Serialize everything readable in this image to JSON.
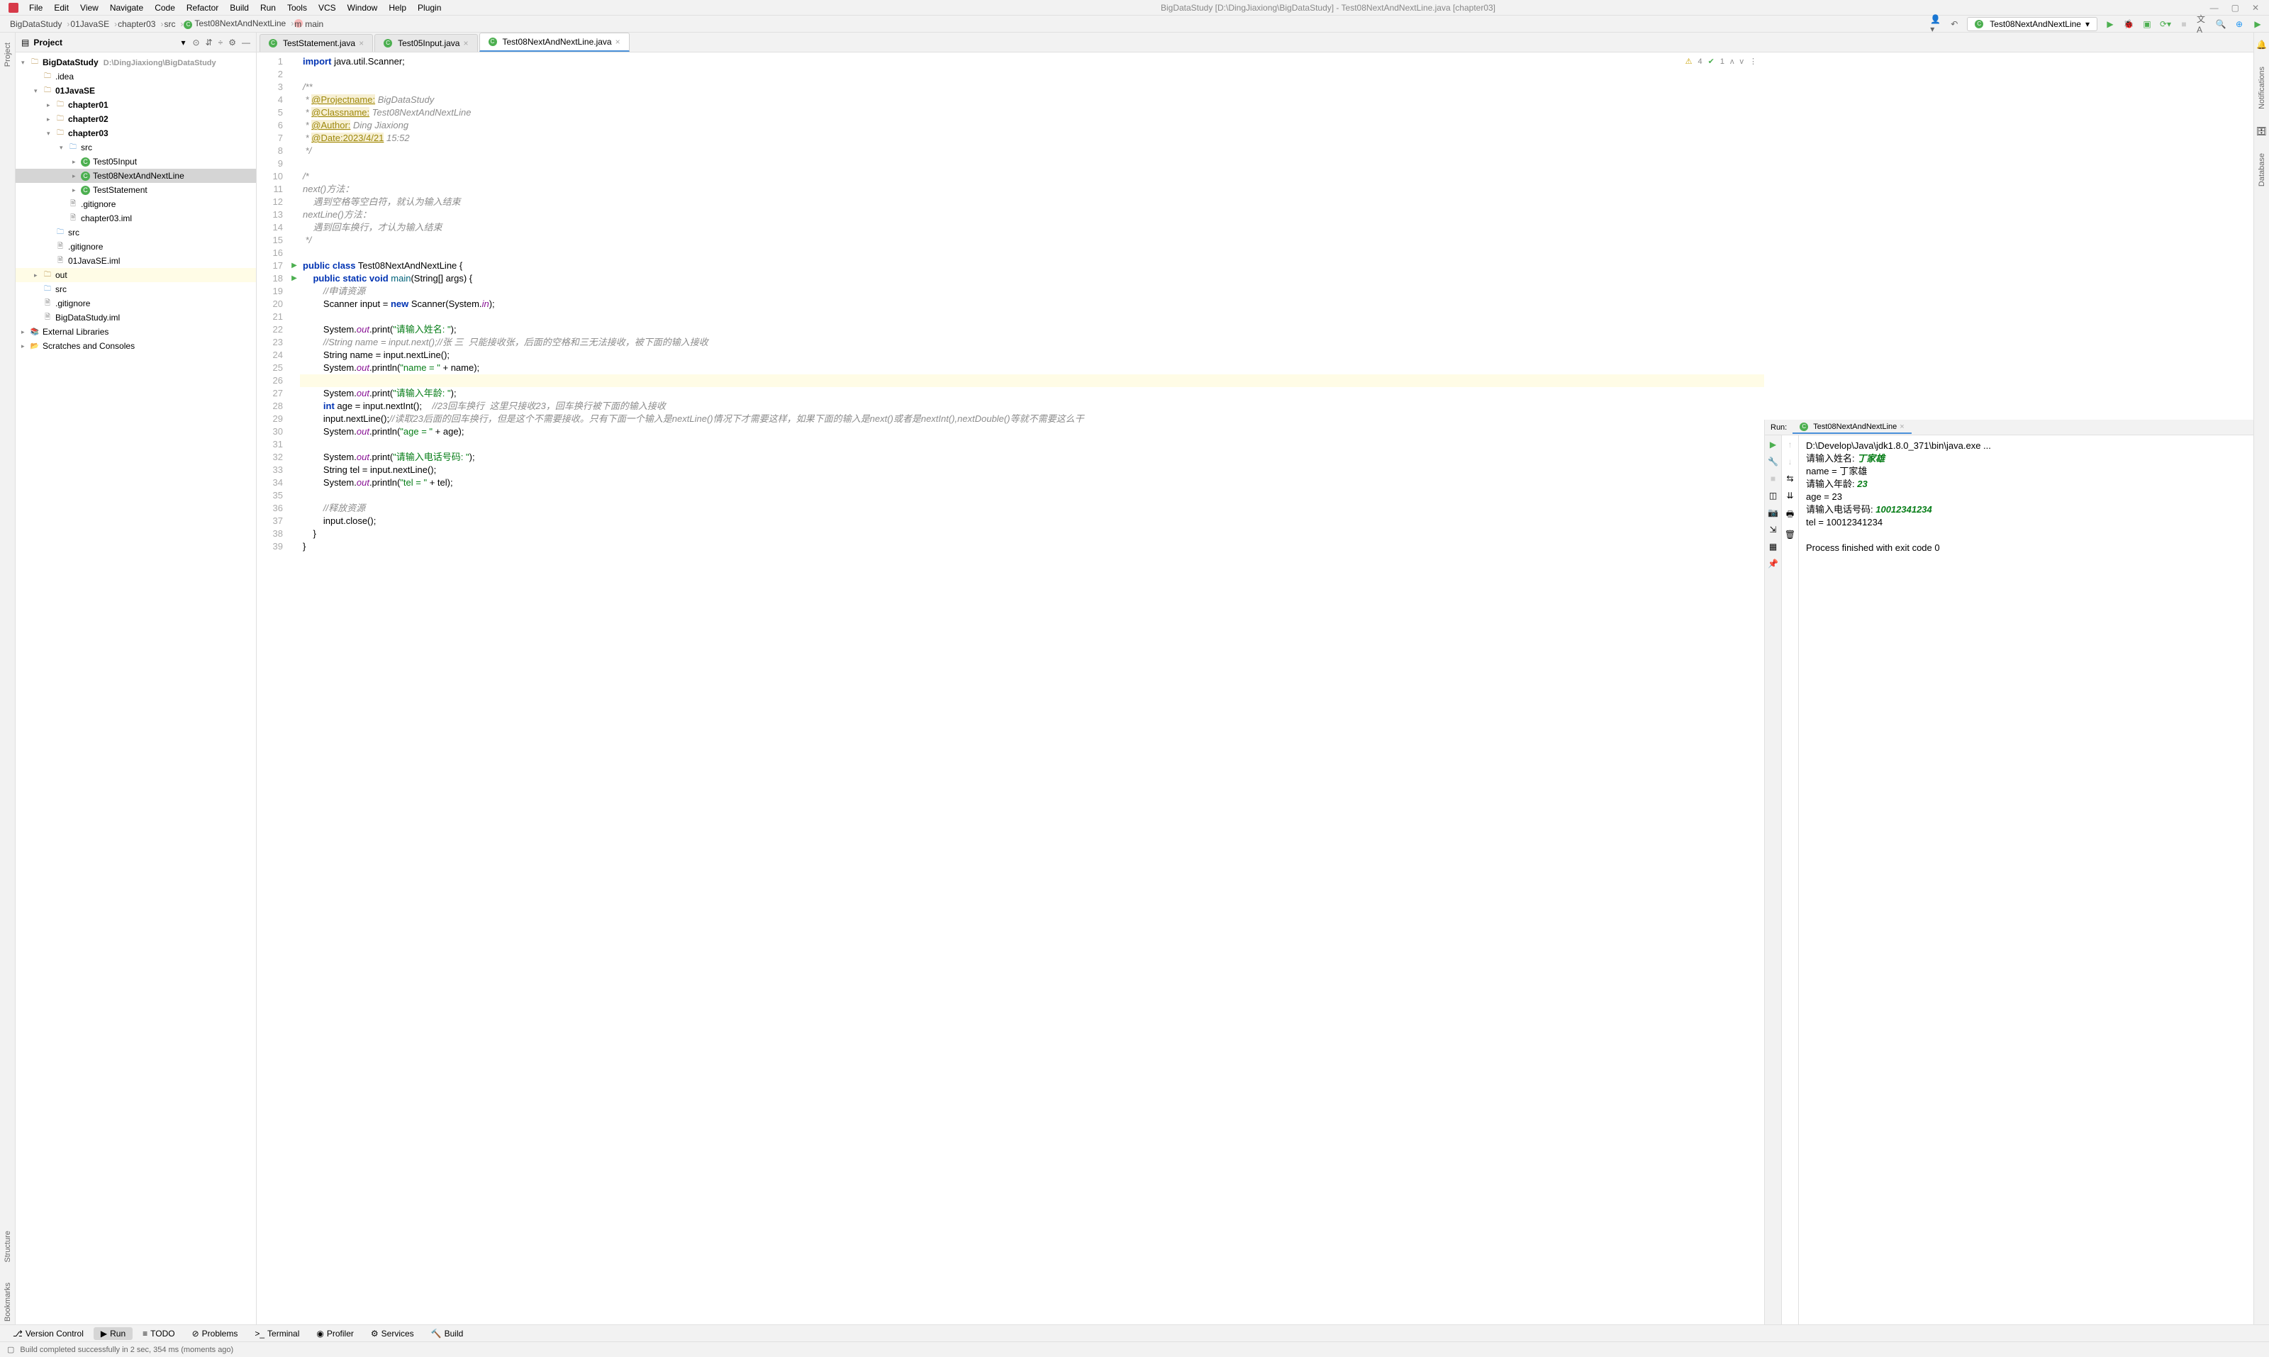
{
  "window": {
    "title": "BigDataStudy [D:\\DingJiaxiong\\BigDataStudy] - Test08NextAndNextLine.java [chapter03]"
  },
  "menu": [
    "File",
    "Edit",
    "View",
    "Navigate",
    "Code",
    "Refactor",
    "Build",
    "Run",
    "Tools",
    "VCS",
    "Window",
    "Help",
    "Plugin"
  ],
  "breadcrumbs": [
    {
      "label": "BigDataStudy"
    },
    {
      "label": "01JavaSE"
    },
    {
      "label": "chapter03"
    },
    {
      "label": "src"
    },
    {
      "label": "Test08NextAndNextLine",
      "icon": "class"
    },
    {
      "label": "main",
      "icon": "method"
    }
  ],
  "run_config": "Test08NextAndNextLine",
  "project_panel": {
    "title": "Project"
  },
  "tree": [
    {
      "indent": 0,
      "arrow": "▾",
      "icon": "folder",
      "label": "BigDataStudy",
      "path": "D:\\DingJiaxiong\\BigDataStudy",
      "bold": true
    },
    {
      "indent": 1,
      "arrow": "",
      "icon": "folder",
      "label": ".idea"
    },
    {
      "indent": 1,
      "arrow": "▾",
      "icon": "folder",
      "label": "01JavaSE",
      "bold": true
    },
    {
      "indent": 2,
      "arrow": "▸",
      "icon": "folder",
      "label": "chapter01",
      "bold": true
    },
    {
      "indent": 2,
      "arrow": "▸",
      "icon": "folder",
      "label": "chapter02",
      "bold": true
    },
    {
      "indent": 2,
      "arrow": "▾",
      "icon": "folder",
      "label": "chapter03",
      "bold": true
    },
    {
      "indent": 3,
      "arrow": "▾",
      "icon": "folder-blue",
      "label": "src"
    },
    {
      "indent": 4,
      "arrow": "▸",
      "icon": "class",
      "label": "Test05Input"
    },
    {
      "indent": 4,
      "arrow": "▸",
      "icon": "class",
      "label": "Test08NextAndNextLine",
      "selected": true
    },
    {
      "indent": 4,
      "arrow": "▸",
      "icon": "class",
      "label": "TestStatement"
    },
    {
      "indent": 3,
      "arrow": "",
      "icon": "file",
      "label": ".gitignore"
    },
    {
      "indent": 3,
      "arrow": "",
      "icon": "file",
      "label": "chapter03.iml"
    },
    {
      "indent": 2,
      "arrow": "",
      "icon": "folder-blue",
      "label": "src"
    },
    {
      "indent": 2,
      "arrow": "",
      "icon": "file",
      "label": ".gitignore"
    },
    {
      "indent": 2,
      "arrow": "",
      "icon": "file",
      "label": "01JavaSE.iml"
    },
    {
      "indent": 1,
      "arrow": "▸",
      "icon": "folder",
      "label": "out",
      "highlighted": true
    },
    {
      "indent": 1,
      "arrow": "",
      "icon": "folder-blue",
      "label": "src"
    },
    {
      "indent": 1,
      "arrow": "",
      "icon": "file",
      "label": ".gitignore"
    },
    {
      "indent": 1,
      "arrow": "",
      "icon": "file",
      "label": "BigDataStudy.iml"
    },
    {
      "indent": 0,
      "arrow": "▸",
      "icon": "lib",
      "label": "External Libraries"
    },
    {
      "indent": 0,
      "arrow": "▸",
      "icon": "scratch",
      "label": "Scratches and Consoles"
    }
  ],
  "tabs": [
    {
      "label": "TestStatement.java"
    },
    {
      "label": "Test05Input.java"
    },
    {
      "label": "Test08NextAndNextLine.java",
      "active": true
    }
  ],
  "editor_status": {
    "warnings": "4",
    "ok": "1"
  },
  "code_lines": [
    {
      "n": 1,
      "html": "<span class='kw'>import</span> java.util.Scanner;"
    },
    {
      "n": 2,
      "html": ""
    },
    {
      "n": 3,
      "html": "<span class='com'>/**</span>"
    },
    {
      "n": 4,
      "html": "<span class='com'> * </span><span class='ann'>@Projectname:</span><span class='com'> BigDataStudy</span>"
    },
    {
      "n": 5,
      "html": "<span class='com'> * </span><span class='ann'>@Classname:</span><span class='com'> Test08NextAndNextLine</span>"
    },
    {
      "n": 6,
      "html": "<span class='com'> * </span><span class='ann'>@Author:</span><span class='com'> Ding Jiaxiong</span>"
    },
    {
      "n": 7,
      "html": "<span class='com'> * </span><span class='ann'>@Date:2023/4/21</span><span class='com'> 15:52</span>"
    },
    {
      "n": 8,
      "html": "<span class='com'> */</span>"
    },
    {
      "n": 9,
      "html": ""
    },
    {
      "n": 10,
      "html": "<span class='com'>/*</span>"
    },
    {
      "n": 11,
      "html": "<span class='com'>next()方法：</span>"
    },
    {
      "n": 12,
      "html": "<span class='com'>    遇到空格等空白符，就认为输入结束</span>"
    },
    {
      "n": 13,
      "html": "<span class='com'>nextLine()方法：</span>"
    },
    {
      "n": 14,
      "html": "<span class='com'>    遇到回车换行，才认为输入结束</span>"
    },
    {
      "n": 15,
      "html": "<span class='com'> */</span>"
    },
    {
      "n": 16,
      "html": ""
    },
    {
      "n": 17,
      "html": "<span class='kw'>public class</span> <span class='type'>Test08NextAndNextLine</span> {",
      "run": true
    },
    {
      "n": 18,
      "html": "    <span class='kw'>public static void</span> <span class='fn'>main</span>(String[] args) {",
      "run": true
    },
    {
      "n": 19,
      "html": "        <span class='com'>//申请资源</span>"
    },
    {
      "n": 20,
      "html": "        Scanner input = <span class='kw'>new</span> Scanner(System.<span class='fld'>in</span>);"
    },
    {
      "n": 21,
      "html": ""
    },
    {
      "n": 22,
      "html": "        System.<span class='fld'>out</span>.print(<span class='str'>\"请输入姓名: \"</span>);"
    },
    {
      "n": 23,
      "html": "        <span class='com'>//String name = input.next();//张 三  只能接收张，后面的空格和三无法接收，被下面的输入接收</span>"
    },
    {
      "n": 24,
      "html": "        String name = input.nextLine();"
    },
    {
      "n": 25,
      "html": "        System.<span class='fld'>out</span>.println(<span class='str'>\"name = \"</span> + name);"
    },
    {
      "n": 26,
      "html": "",
      "hl": true
    },
    {
      "n": 27,
      "html": "        System.<span class='fld'>out</span>.print(<span class='str'>\"请输入年龄: \"</span>);"
    },
    {
      "n": 28,
      "html": "        <span class='kw'>int</span> age = input.nextInt();    <span class='com'>//23回车换行  这里只接收23，回车换行被下面的输入接收</span>"
    },
    {
      "n": 29,
      "html": "        input.nextLine();<span class='com'>//读取23后面的回车换行，但是这个不需要接收。只有下面一个输入是nextLine()情况下才需要这样，如果下面的输入是next()或者是nextInt(),nextDouble()等就不需要这么干</span>"
    },
    {
      "n": 30,
      "html": "        System.<span class='fld'>out</span>.println(<span class='str'>\"age = \"</span> + age);"
    },
    {
      "n": 31,
      "html": ""
    },
    {
      "n": 32,
      "html": "        System.<span class='fld'>out</span>.print(<span class='str'>\"请输入电话号码: \"</span>);"
    },
    {
      "n": 33,
      "html": "        String tel = input.nextLine();"
    },
    {
      "n": 34,
      "html": "        System.<span class='fld'>out</span>.println(<span class='str'>\"tel = \"</span> + tel);"
    },
    {
      "n": 35,
      "html": ""
    },
    {
      "n": 36,
      "html": "        <span class='com'>//释放资源</span>"
    },
    {
      "n": 37,
      "html": "        input.close();"
    },
    {
      "n": 38,
      "html": "    }"
    },
    {
      "n": 39,
      "html": "}"
    }
  ],
  "run_panel": {
    "title": "Run:",
    "tab": "Test08NextAndNextLine",
    "lines": [
      {
        "text": "D:\\Develop\\Java\\jdk1.8.0_371\\bin\\java.exe ..."
      },
      {
        "prefix": "请输入姓名: ",
        "input": "丁家雄"
      },
      {
        "text": "name = 丁家雄"
      },
      {
        "prefix": "请输入年龄: ",
        "input": "23"
      },
      {
        "text": "age = 23"
      },
      {
        "prefix": "请输入电话号码: ",
        "input": "10012341234"
      },
      {
        "text": "tel = 10012341234"
      },
      {
        "text": ""
      },
      {
        "text": "Process finished with exit code 0"
      }
    ]
  },
  "bottom_tabs": [
    {
      "label": "Version Control",
      "icon": "⎇"
    },
    {
      "label": "Run",
      "icon": "▶",
      "active": true
    },
    {
      "label": "TODO",
      "icon": "≡"
    },
    {
      "label": "Problems",
      "icon": "⊘"
    },
    {
      "label": "Terminal",
      "icon": ">_"
    },
    {
      "label": "Profiler",
      "icon": "◉"
    },
    {
      "label": "Services",
      "icon": "⚙"
    },
    {
      "label": "Build",
      "icon": "🔨"
    }
  ],
  "statusbar": "Build completed successfully in 2 sec, 354 ms (moments ago)",
  "left_tools": [
    "Project",
    "Structure",
    "Bookmarks"
  ],
  "right_tools": [
    "Notifications",
    "Database"
  ]
}
